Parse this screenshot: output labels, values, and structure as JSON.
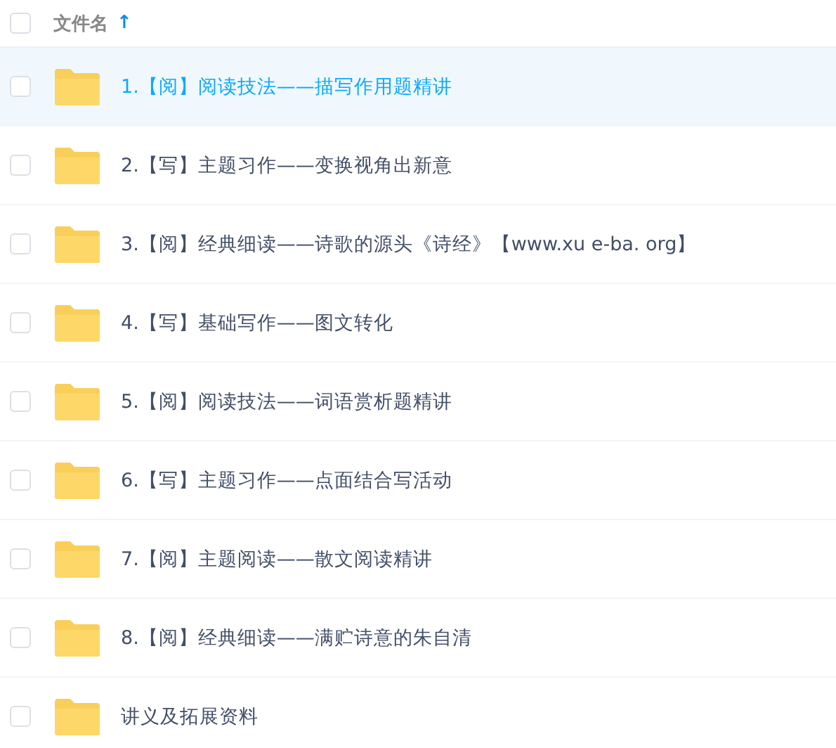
{
  "header": {
    "checked": false,
    "column_label": "文件名",
    "sort_arrow": "↑"
  },
  "files": [
    {
      "name": "1.【阅】阅读技法——描写作用题精讲",
      "checked": false,
      "selected": true
    },
    {
      "name": "2.【写】主题习作——变换视角出新意",
      "checked": false,
      "selected": false
    },
    {
      "name": "3.【阅】经典细读——诗歌的源头《诗经》【www.xu e-ba. org】",
      "checked": false,
      "selected": false
    },
    {
      "name": "4.【写】基础写作——图文转化",
      "checked": false,
      "selected": false
    },
    {
      "name": "5.【阅】阅读技法——词语赏析题精讲",
      "checked": false,
      "selected": false
    },
    {
      "name": "6.【写】主题习作——点面结合写活动",
      "checked": false,
      "selected": false
    },
    {
      "name": "7.【阅】主题阅读——散文阅读精讲",
      "checked": false,
      "selected": false
    },
    {
      "name": "8.【阅】经典细读——满贮诗意的朱自清",
      "checked": false,
      "selected": false
    },
    {
      "name": "讲义及拓展资料",
      "checked": false,
      "selected": false
    }
  ]
}
